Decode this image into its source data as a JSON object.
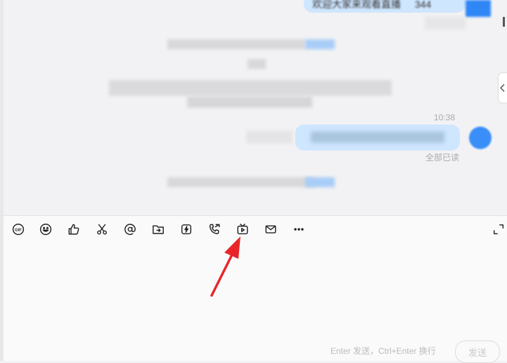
{
  "chat": {
    "top_bubble_text": "欢迎大家来观看直播",
    "top_bubble_number": "344",
    "message_time": "10:38",
    "read_status": "全部已读"
  },
  "toolbar": {
    "icons": [
      "gif-icon",
      "emoji-icon",
      "thumbs-up-icon",
      "scissors-icon",
      "at-icon",
      "folder-icon",
      "lightning-icon",
      "call-icon",
      "live-tv-icon",
      "mail-icon",
      "more-icon",
      "expand-icon"
    ]
  },
  "composer": {
    "hint": "Enter 发送，Ctrl+Enter 换行",
    "send_label": "发送"
  },
  "colors": {
    "bubble": "#cfe6ff",
    "accent": "#3a8ef8",
    "annotation_arrow": "#e8262a"
  }
}
